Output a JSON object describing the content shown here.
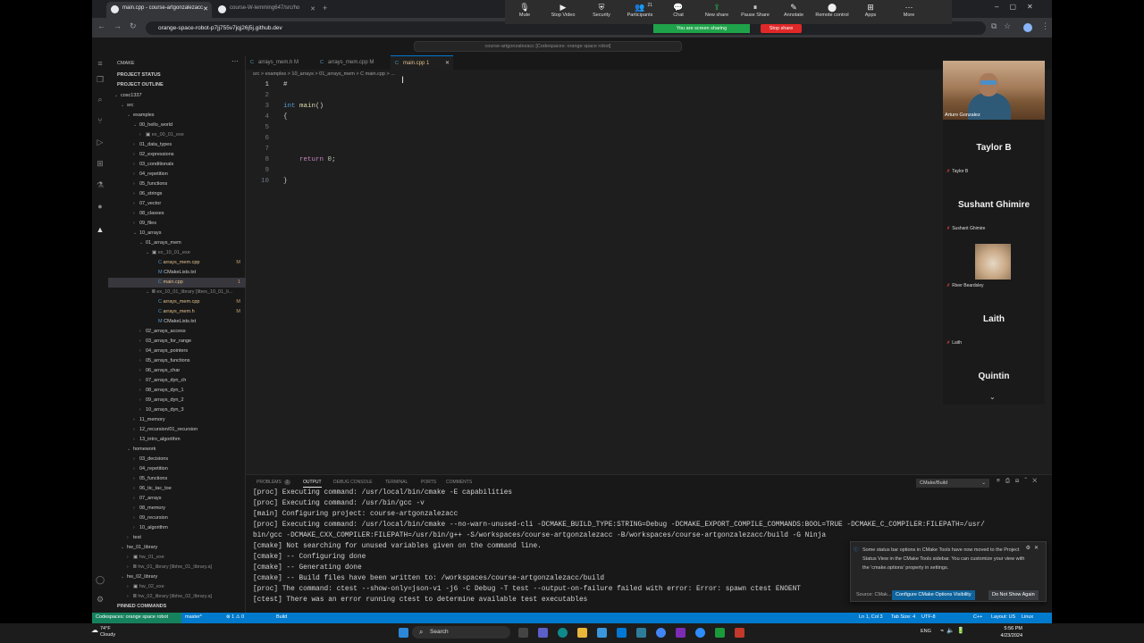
{
  "browser": {
    "tabs": [
      {
        "title": "main.cpp - course-artgonzalezacc",
        "active": true
      },
      {
        "title": "course-W-lemming647/src/ho",
        "active": false
      }
    ],
    "url": "orange-space-robot-p7jj755v7jqj26j5j.github.dev"
  },
  "zoom": {
    "buttons": [
      {
        "label": "Mute",
        "icon": "microphone-icon"
      },
      {
        "label": "Stop Video",
        "icon": "video-icon"
      },
      {
        "label": "Security",
        "icon": "shield-icon"
      },
      {
        "label": "Participants",
        "icon": "participants-icon",
        "count": "21"
      },
      {
        "label": "Chat",
        "icon": "chat-icon"
      },
      {
        "label": "New share",
        "icon": "share-icon"
      },
      {
        "label": "Pause Share",
        "icon": "pause-icon"
      },
      {
        "label": "Annotate",
        "icon": "pencil-icon"
      },
      {
        "label": "Remote control",
        "icon": "mouse-icon"
      },
      {
        "label": "Apps",
        "icon": "apps-icon"
      },
      {
        "label": "More",
        "icon": "more-icon"
      }
    ],
    "sharing_label": "You are screen sharing",
    "stop_label": "Stop share"
  },
  "vscode": {
    "command_center": "course-artgonzalezacc [Codespaces: orange space robot]",
    "sidebar_title": "CMAKE",
    "project_status": "PROJECT STATUS",
    "project_outline": "PROJECT OUTLINE",
    "pinned": "PINNED COMMANDS",
    "tree": [
      {
        "label": "cosc1337",
        "indent": 1,
        "chev": "v"
      },
      {
        "label": "src",
        "indent": 2,
        "chev": "v"
      },
      {
        "label": "examples",
        "indent": 3,
        "chev": "v"
      },
      {
        "label": "00_hello_world",
        "indent": 4,
        "chev": "v"
      },
      {
        "label": "ex_00_01_exe",
        "indent": 5,
        "chev": ">",
        "icon": "▣",
        "muted": true
      },
      {
        "label": "01_data_types",
        "indent": 4,
        "chev": ">"
      },
      {
        "label": "02_expressions",
        "indent": 4,
        "chev": ">"
      },
      {
        "label": "03_conditionals",
        "indent": 4,
        "chev": ">"
      },
      {
        "label": "04_repetition",
        "indent": 4,
        "chev": ">"
      },
      {
        "label": "05_functions",
        "indent": 4,
        "chev": ">"
      },
      {
        "label": "06_strings",
        "indent": 4,
        "chev": ">"
      },
      {
        "label": "07_vector",
        "indent": 4,
        "chev": ">"
      },
      {
        "label": "08_classes",
        "indent": 4,
        "chev": ">"
      },
      {
        "label": "09_files",
        "indent": 4,
        "chev": ">"
      },
      {
        "label": "10_arrays",
        "indent": 4,
        "chev": "v"
      },
      {
        "label": "01_arrays_mem",
        "indent": 5,
        "chev": "v"
      },
      {
        "label": "ex_10_01_exe",
        "indent": 6,
        "chev": "v",
        "icon": "▣",
        "muted": true
      },
      {
        "label": "arrays_mem.cpp",
        "indent": 7,
        "icon": "C",
        "deco": "M",
        "mod": true
      },
      {
        "label": "CMakeLists.txt",
        "indent": 7,
        "icon": "M"
      },
      {
        "label": "main.cpp",
        "indent": 7,
        "icon": "C",
        "deco": "1",
        "mod": true,
        "selected": true
      },
      {
        "label": "ex_10_01_library [libex_10_01_li...",
        "indent": 6,
        "chev": "v",
        "icon": "Ⅲ",
        "muted": true
      },
      {
        "label": "arrays_mem.cpp",
        "indent": 7,
        "icon": "C",
        "deco": "M",
        "mod": true
      },
      {
        "label": "arrays_mem.h",
        "indent": 7,
        "icon": "C",
        "deco": "M",
        "mod": true
      },
      {
        "label": "CMakeLists.txt",
        "indent": 7,
        "icon": "M"
      },
      {
        "label": "02_arrays_access",
        "indent": 5,
        "chev": ">"
      },
      {
        "label": "03_arrays_for_range",
        "indent": 5,
        "chev": ">"
      },
      {
        "label": "04_arrays_pointers",
        "indent": 5,
        "chev": ">"
      },
      {
        "label": "05_arrays_functions",
        "indent": 5,
        "chev": ">"
      },
      {
        "label": "06_arrays_char",
        "indent": 5,
        "chev": ">"
      },
      {
        "label": "07_arrays_dyn_ch",
        "indent": 5,
        "chev": ">"
      },
      {
        "label": "08_arrays_dyn_1",
        "indent": 5,
        "chev": ">"
      },
      {
        "label": "09_arrays_dyn_2",
        "indent": 5,
        "chev": ">"
      },
      {
        "label": "10_arrays_dyn_3",
        "indent": 5,
        "chev": ">"
      },
      {
        "label": "11_memory",
        "indent": 4,
        "chev": ">"
      },
      {
        "label": "12_recursion/01_recursion",
        "indent": 4,
        "chev": ">"
      },
      {
        "label": "13_intro_algorithm",
        "indent": 4,
        "chev": ">"
      },
      {
        "label": "homework",
        "indent": 3,
        "chev": "v"
      },
      {
        "label": "03_decisions",
        "indent": 4,
        "chev": ">"
      },
      {
        "label": "04_repetition",
        "indent": 4,
        "chev": ">"
      },
      {
        "label": "05_functions",
        "indent": 4,
        "chev": ">"
      },
      {
        "label": "06_tic_tac_toe",
        "indent": 4,
        "chev": ">"
      },
      {
        "label": "07_arrays",
        "indent": 4,
        "chev": ">"
      },
      {
        "label": "08_memory",
        "indent": 4,
        "chev": ">"
      },
      {
        "label": "09_recursion",
        "indent": 4,
        "chev": ">"
      },
      {
        "label": "10_algorithm",
        "indent": 4,
        "chev": ">"
      },
      {
        "label": "test",
        "indent": 3,
        "chev": ">"
      },
      {
        "label": "hw_01_library",
        "indent": 2,
        "chev": "v"
      },
      {
        "label": "hw_01_exe",
        "indent": 3,
        "chev": ">",
        "icon": "▣",
        "muted": true
      },
      {
        "label": "hw_01_library [libhw_01_library.a]",
        "indent": 3,
        "chev": ">",
        "icon": "Ⅲ",
        "muted": true
      },
      {
        "label": "hw_02_library",
        "indent": 2,
        "chev": "v"
      },
      {
        "label": "hw_02_exe",
        "indent": 3,
        "chev": ">",
        "icon": "▣",
        "muted": true
      },
      {
        "label": "hw_02_library [libhw_02_library.a]",
        "indent": 3,
        "chev": ">",
        "icon": "Ⅲ",
        "muted": true
      }
    ],
    "editor_tabs": [
      {
        "label": "arrays_mem.h M",
        "active": false
      },
      {
        "label": "arrays_mem.cpp M",
        "active": false
      },
      {
        "label": "main.cpp 1",
        "active": true
      }
    ],
    "breadcrumbs": "src > examples > 10_arrays > 01_arrays_mem > C main.cpp > ...",
    "code": [
      {
        "n": "1",
        "t": "#"
      },
      {
        "n": "2",
        "t": ""
      },
      {
        "n": "3",
        "t": "int main()"
      },
      {
        "n": "4",
        "t": "{"
      },
      {
        "n": "5",
        "t": ""
      },
      {
        "n": "6",
        "t": ""
      },
      {
        "n": "7",
        "t": ""
      },
      {
        "n": "8",
        "t": "    return 0;"
      },
      {
        "n": "9",
        "t": ""
      },
      {
        "n": "10",
        "t": "}"
      }
    ],
    "panel_tabs": [
      {
        "label": "PROBLEMS",
        "badge": "1"
      },
      {
        "label": "OUTPUT",
        "active": true
      },
      {
        "label": "DEBUG CONSOLE"
      },
      {
        "label": "TERMINAL"
      },
      {
        "label": "PORTS"
      },
      {
        "label": "COMMENTS"
      }
    ],
    "output_channel": "CMake/Build",
    "output": [
      "[proc] Executing command: /usr/local/bin/cmake -E capabilities",
      "[proc] Executing command: /usr/bin/gcc -v",
      "[main] Configuring project: course-artgonzalezacc",
      "[proc] Executing command: /usr/local/bin/cmake --no-warn-unused-cli -DCMAKE_BUILD_TYPE:STRING=Debug -DCMAKE_EXPORT_COMPILE_COMMANDS:BOOL=TRUE -DCMAKE_C_COMPILER:FILEPATH=/usr/",
      "bin/gcc -DCMAKE_CXX_COMPILER:FILEPATH=/usr/bin/g++ -S/workspaces/course-artgonzalezacc -B/workspaces/course-artgonzalezacc/build -G Ninja",
      "[cmake] Not searching for unused variables given on the command line.",
      "[cmake] -- Configuring done",
      "[cmake] -- Generating done",
      "[cmake] -- Build files have been written to: /workspaces/course-artgonzalezacc/build",
      "[proc] The command: ctest --show-only=json-v1 -j6 -C Debug -T test --output-on-failure failed with error: Error: spawn ctest ENOENT",
      "[ctest] There was an error running ctest to determine available test executables"
    ],
    "notification": {
      "message": "Some status bar options in CMake Tools have now moved to the Project Status View in the CMake Tools sidebar. You can customize your view with the 'cmake.options' property in settings.",
      "source": "Source: CMak...",
      "primary": "Configure CMake Options Visibility",
      "secondary": "Do Not Show Again"
    },
    "status": {
      "remote": "Codespaces: orange space robot",
      "branch": "master*",
      "problems": "⊗ 1 ⚠ 0",
      "build": "Build",
      "cursor": "Ln 1, Col 3",
      "tab": "Tab Size: 4",
      "enc": "UTF-8",
      "lang": "C++",
      "layout": "Layout: US",
      "os": "Linux"
    }
  },
  "participants": {
    "video_name": "Arturo Gonzalez",
    "list": [
      {
        "big": "Taylor B",
        "small": "Taylor B"
      },
      {
        "big": "Sushant Ghimire",
        "small": "Sushant Ghimire"
      },
      {
        "big": "",
        "small": "River Beardsley"
      },
      {
        "big": "Laith",
        "small": "Laith"
      },
      {
        "big": "Quintin",
        "small": ""
      }
    ]
  },
  "taskbar": {
    "search": "Search",
    "weather_temp": "74°F",
    "weather_desc": "Cloudy",
    "lang": "ENG",
    "time": "5:56 PM",
    "date": "4/23/2024"
  }
}
